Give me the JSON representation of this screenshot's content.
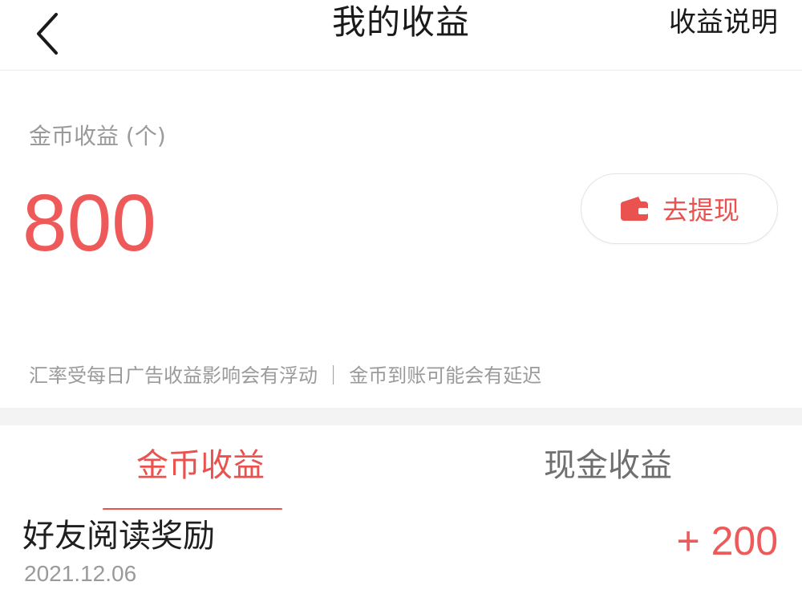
{
  "header": {
    "title": "我的收益",
    "help_label": "收益说明"
  },
  "balance": {
    "label": "金币收益 (个)",
    "value": "800",
    "withdraw_label": "去提现",
    "notice": "汇率受每日广告收益影响会有浮动 ｜ 金币到账可能会有延迟"
  },
  "tabs": [
    {
      "label": "金币收益",
      "active": true
    },
    {
      "label": "现金收益",
      "active": false
    }
  ],
  "records": [
    {
      "title": "好友阅读奖励",
      "date": "2021.12.06",
      "amount": "+ 200"
    }
  ],
  "colors": {
    "accent": "#e9524f",
    "value_red": "#ee5a5a",
    "muted_text": "#9a9a9a"
  },
  "icons": {
    "back": "chevron-left-icon",
    "withdraw": "wallet-icon"
  }
}
